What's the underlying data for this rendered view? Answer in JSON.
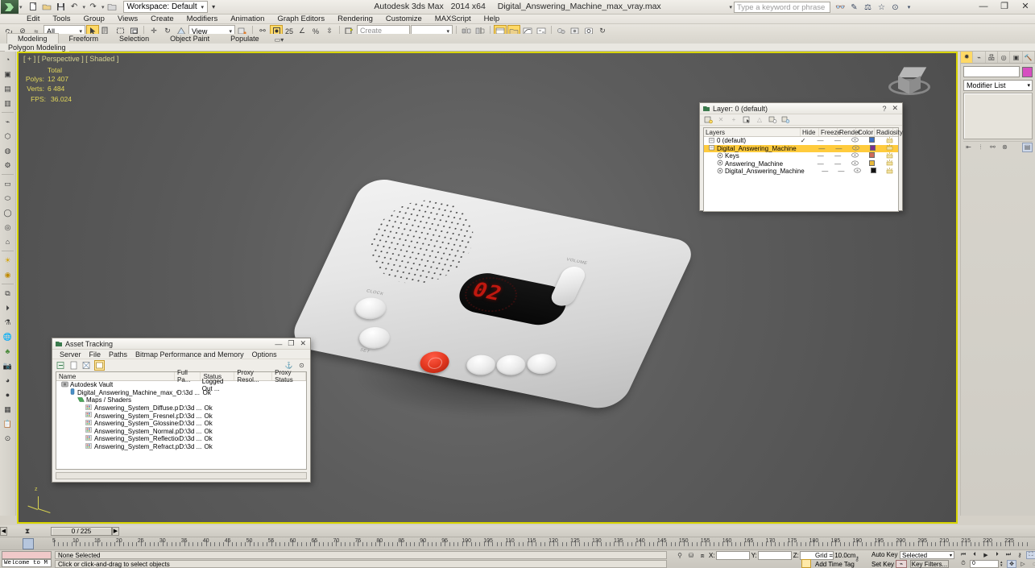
{
  "app": {
    "title_product": "Autodesk 3ds Max",
    "title_version": "2014 x64",
    "title_file": "Digital_Answering_Machine_max_vray.max",
    "workspace_label": "Workspace: Default"
  },
  "search": {
    "placeholder": "Type a keyword or phrase"
  },
  "window_controls": {
    "minimize": "—",
    "maximize": "❐",
    "close": "✕"
  },
  "menu": {
    "items": [
      "Edit",
      "Tools",
      "Group",
      "Views",
      "Create",
      "Modifiers",
      "Animation",
      "Graph Editors",
      "Rendering",
      "Customize",
      "MAXScript",
      "Help"
    ]
  },
  "quick_access": {
    "new": "new-file",
    "open": "open-file",
    "save": "save-file",
    "undo": "undo",
    "redo": "redo",
    "setproject": "set-project"
  },
  "main_toolbar": {
    "selection_filter": "All",
    "ref_coord_system": "View",
    "selection_set": "Create Selection Se",
    "named_set_placeholder": "Create Selection Se",
    "percent_snap": "25"
  },
  "ribbon": {
    "tabs": [
      "Modeling",
      "Freeform",
      "Selection",
      "Object Paint",
      "Populate"
    ],
    "active_tab": "Modeling",
    "panel_label": "Polygon Modeling"
  },
  "viewport": {
    "label": "[ + ] [ Perspective ] [ Shaded ]",
    "stats_header": "Total",
    "polys_label": "Polys:",
    "polys_value": "12 407",
    "verts_label": "Verts:",
    "verts_value": "6 484",
    "fps_label": "FPS:",
    "fps_value": "36.024"
  },
  "device": {
    "display_value": "02",
    "label_clock": "CLOCK",
    "label_set": "SET",
    "label_volume": "VOLUME"
  },
  "command_panel": {
    "tabs": [
      "create",
      "modify",
      "hierarchy",
      "motion",
      "display",
      "utilities"
    ],
    "active_tab": "create",
    "object_name": "",
    "modifier_list": "Modifier List",
    "color_swatch": "#d64fc0"
  },
  "layer_window": {
    "title": "Layer: 0 (default)",
    "help_btn": "?",
    "close_btn": "✕",
    "columns": [
      "Layers",
      "Hide",
      "Freeze",
      "Render",
      "Color",
      "Radiosity"
    ],
    "rows": [
      {
        "name": "0 (default)",
        "indent": 0,
        "current": "✓",
        "hide": "—",
        "freeze": "—",
        "render": "eye-icon",
        "color": "#3a6fc4",
        "selected": false
      },
      {
        "name": "Digital_Answering_Machine",
        "indent": 0,
        "current": "",
        "hide": "—",
        "freeze": "—",
        "render": "eye-icon",
        "color": "#7a2f8f",
        "selected": true
      },
      {
        "name": "Keys",
        "indent": 1,
        "current": "",
        "hide": "—",
        "freeze": "—",
        "render": "eye-icon",
        "color": "#d06a5a",
        "selected": false
      },
      {
        "name": "Answering_Machine",
        "indent": 1,
        "current": "",
        "hide": "—",
        "freeze": "—",
        "render": "eye-icon",
        "color": "#e8b93a",
        "selected": false
      },
      {
        "name": "Digital_Answering_Machine",
        "indent": 1,
        "current": "",
        "hide": "—",
        "freeze": "—",
        "render": "eye-icon",
        "color": "#121212",
        "selected": false
      }
    ]
  },
  "asset_window": {
    "title": "Asset Tracking",
    "controls": {
      "minimize": "—",
      "maximize": "❐",
      "close": "✕"
    },
    "menu": [
      "Server",
      "File",
      "Paths",
      "Bitmap Performance and Memory",
      "Options"
    ],
    "columns": [
      "Name",
      "Full Pa...",
      "Status",
      "Proxy Resol...",
      "Proxy Status"
    ],
    "rows": [
      {
        "name": "Autodesk Vault",
        "indent": 0,
        "icon": "vault-icon",
        "path": "",
        "status": "Logged Out ...",
        "proxy_res": "",
        "proxy_status": ""
      },
      {
        "name": "Digital_Answering_Machine_max_vray.max",
        "indent": 1,
        "icon": "scene-icon",
        "path": "D:\\3d ...",
        "status": "Ok",
        "proxy_res": "",
        "proxy_status": ""
      },
      {
        "name": "Maps / Shaders",
        "indent": 2,
        "icon": "maps-icon",
        "path": "",
        "status": "",
        "proxy_res": "",
        "proxy_status": ""
      },
      {
        "name": "Answering_System_Diffuse.png",
        "indent": 3,
        "icon": "bitmap-icon",
        "path": "D:\\3d ...",
        "status": "Ok",
        "proxy_res": "",
        "proxy_status": ""
      },
      {
        "name": "Answering_System_Fresnel.png",
        "indent": 3,
        "icon": "bitmap-icon",
        "path": "D:\\3d ...",
        "status": "Ok",
        "proxy_res": "",
        "proxy_status": ""
      },
      {
        "name": "Answering_System_Glossiness.png",
        "indent": 3,
        "icon": "bitmap-icon",
        "path": "D:\\3d ...",
        "status": "Ok",
        "proxy_res": "",
        "proxy_status": ""
      },
      {
        "name": "Answering_System_Normal.png",
        "indent": 3,
        "icon": "bitmap-icon",
        "path": "D:\\3d ...",
        "status": "Ok",
        "proxy_res": "",
        "proxy_status": ""
      },
      {
        "name": "Answering_System_Reflection.png",
        "indent": 3,
        "icon": "bitmap-icon",
        "path": "D:\\3d ...",
        "status": "Ok",
        "proxy_res": "",
        "proxy_status": ""
      },
      {
        "name": "Answering_System_Refract.png",
        "indent": 3,
        "icon": "bitmap-icon",
        "path": "D:\\3d ...",
        "status": "Ok",
        "proxy_res": "",
        "proxy_status": ""
      }
    ]
  },
  "timeline": {
    "current_frame": "0 / 225",
    "tick_labels": [
      "5",
      "10",
      "15",
      "20",
      "25",
      "30",
      "35",
      "40",
      "45",
      "50",
      "55",
      "60",
      "65",
      "70",
      "75",
      "80",
      "85",
      "90",
      "95",
      "100",
      "105",
      "110",
      "115",
      "120",
      "125",
      "130",
      "135",
      "140",
      "145",
      "150",
      "155",
      "160",
      "165",
      "170",
      "175",
      "180",
      "185",
      "190",
      "195",
      "200",
      "205",
      "210",
      "215",
      "220",
      "225"
    ]
  },
  "status_bar": {
    "maxscript_listener": "Welcome to M",
    "selection_status": "None Selected",
    "prompt": "Click or click-and-drag to select objects",
    "coord_x_label": "X:",
    "coord_y_label": "Y:",
    "coord_z_label": "Z:",
    "coord_x": "",
    "coord_y": "",
    "coord_z": "",
    "grid": "Grid = 10.0cm",
    "add_time_tag": "Add Time Tag",
    "auto_key": "Auto Key",
    "set_key": "Set Key",
    "key_mode": "Selected",
    "key_filters": "Key Filters...",
    "playback_frame": "0"
  }
}
